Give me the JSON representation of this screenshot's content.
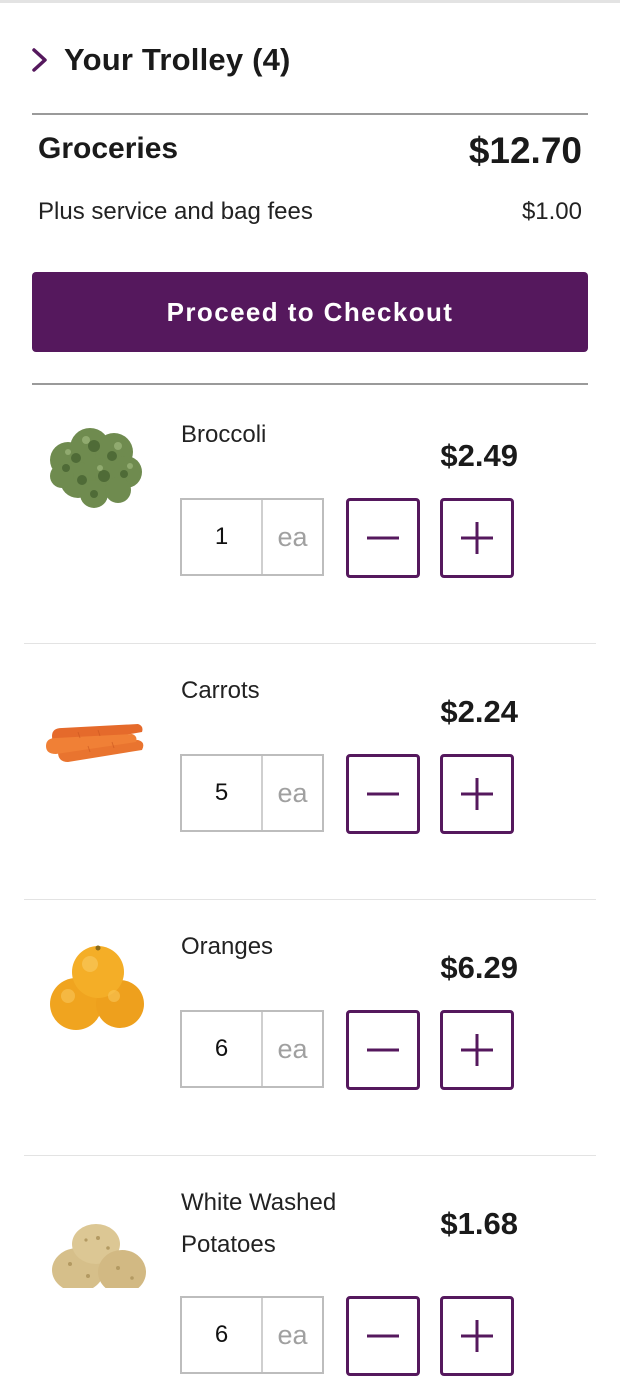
{
  "header": {
    "title": "Your Trolley (4)"
  },
  "summary": {
    "groceries_label": "Groceries",
    "groceries_total": "$12.70",
    "fees_label": "Plus service and bag fees",
    "fees_value": "$1.00"
  },
  "checkout": {
    "label": "Proceed to Checkout"
  },
  "colors": {
    "accent": "#55185d",
    "divider": "#9a9a9a"
  },
  "items": [
    {
      "name": "Broccoli",
      "price": "$2.49",
      "quantity": "1",
      "unit": "ea",
      "image": "broccoli-image"
    },
    {
      "name": "Carrots",
      "price": "$2.24",
      "quantity": "5",
      "unit": "ea",
      "image": "carrots-image"
    },
    {
      "name": "Oranges",
      "price": "$6.29",
      "quantity": "6",
      "unit": "ea",
      "image": "oranges-image"
    },
    {
      "name": "White Washed Potatoes",
      "price": "$1.68",
      "quantity": "6",
      "unit": "ea",
      "image": "potatoes-image"
    }
  ],
  "icons": {
    "header": "chevron-right-icon",
    "minus": "minus-icon",
    "plus": "plus-icon"
  }
}
